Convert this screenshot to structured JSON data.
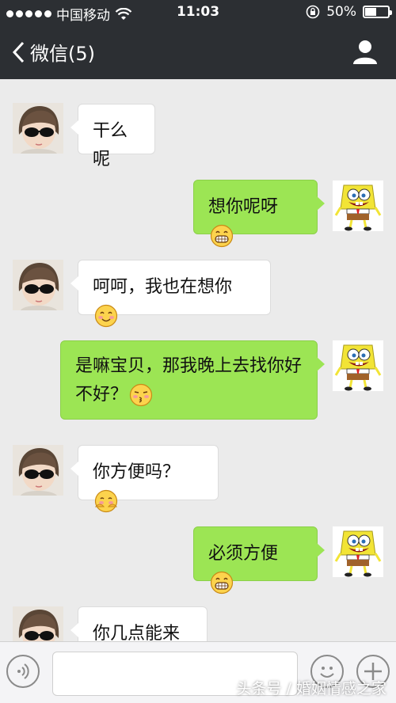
{
  "status_bar": {
    "carrier": "中国移动",
    "time": "11:03",
    "battery": "50%",
    "battery_level": 0.5
  },
  "nav": {
    "title": "微信(5)"
  },
  "messages": [
    {
      "side": "in",
      "text": "干么呢"
    },
    {
      "side": "out",
      "text": "想你呢呀",
      "emoji": "grin-emoji"
    },
    {
      "side": "in",
      "text": "呵呵，我也在想你",
      "emoji": "smile-emoji"
    },
    {
      "side": "out",
      "text_line1": "是嘛宝贝，那我晚上去找你好",
      "text_line2": "不好？",
      "emoji": "kiss-emoji"
    },
    {
      "side": "in",
      "text": "你方便吗？",
      "emoji": "shy-emoji"
    },
    {
      "side": "out",
      "text": "必须方便",
      "emoji": "grin-emoji"
    },
    {
      "side": "in",
      "text": "你几点能来呀"
    }
  ],
  "input": {
    "value": "",
    "placeholder": ""
  },
  "watermark": "头条号 / 婚姻情感之家",
  "colors": {
    "nav_bg": "#2c2f33",
    "chat_bg": "#ebebeb",
    "bubble_out": "#9ce554",
    "bubble_in": "#ffffff"
  }
}
